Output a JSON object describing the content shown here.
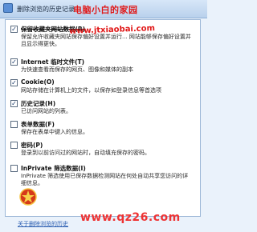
{
  "window": {
    "title": "删除浏览的历史记录",
    "brand_watermark": "电脑小白的家园",
    "url_watermark": "www.jtxiaobai.com",
    "bottom_watermark": "www.qz26.com",
    "help_link": "关于删除浏览的历史"
  },
  "options": [
    {
      "checked": true,
      "title": "保留收藏夹网站数据(R)",
      "desc": "保留允许收藏夹网站保存偏好设置并运行... 网站能够保存偏好设置并且显示得更快。",
      "strike": true
    },
    {
      "checked": true,
      "title": "Internet 临时文件(T)",
      "desc": "为快速查看而保存的网页、图像和媒体的副本"
    },
    {
      "checked": true,
      "title": "Cookie(O)",
      "desc": "网站存储在计算机上的文件，以保存如登录信息等首选项"
    },
    {
      "checked": true,
      "title": "历史记录(H)",
      "desc": "已访问网站的列表。"
    },
    {
      "checked": false,
      "title": "表单数据(F)",
      "desc": "保存在表单中键入的信息。"
    },
    {
      "checked": false,
      "title": "密码(P)",
      "desc": "登录到以前访问过的网站时，自动填充保存的密码。"
    },
    {
      "checked": false,
      "title": "InPrivate 筛选数据(I)",
      "desc": "InPrivate 筛选使用已保存数据检测网站在何处自动共享您访问的详细信息。"
    }
  ]
}
